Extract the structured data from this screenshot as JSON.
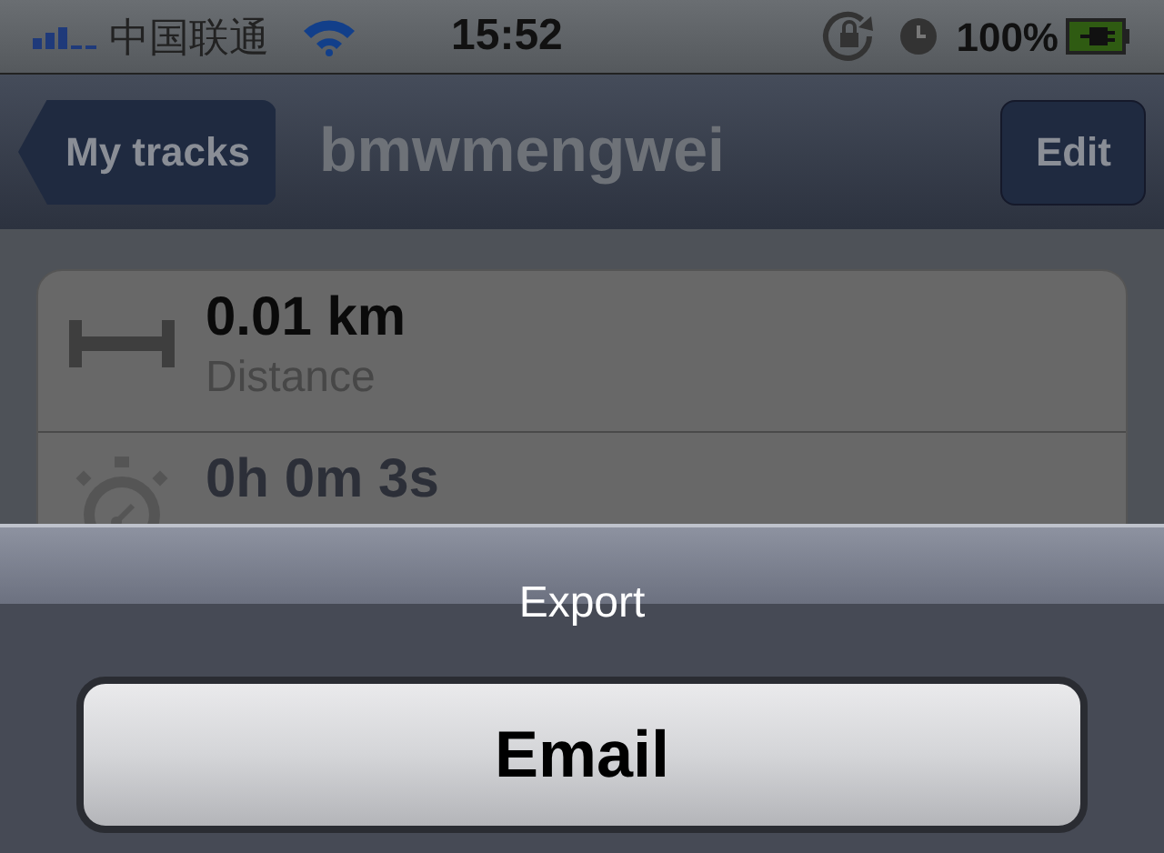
{
  "status_bar": {
    "carrier": "中国联通",
    "time": "15:52",
    "battery": "100%"
  },
  "nav_bar": {
    "back_button": "My tracks",
    "title": "bmwmengwei",
    "right_button": "Edit"
  },
  "stats": [
    {
      "kind": "distance",
      "value": "0.01 km",
      "label": "Distance"
    },
    {
      "kind": "duration",
      "value": "0h 0m 3s"
    }
  ],
  "action_sheet": {
    "title": "Export",
    "buttons": [
      "Email"
    ]
  }
}
